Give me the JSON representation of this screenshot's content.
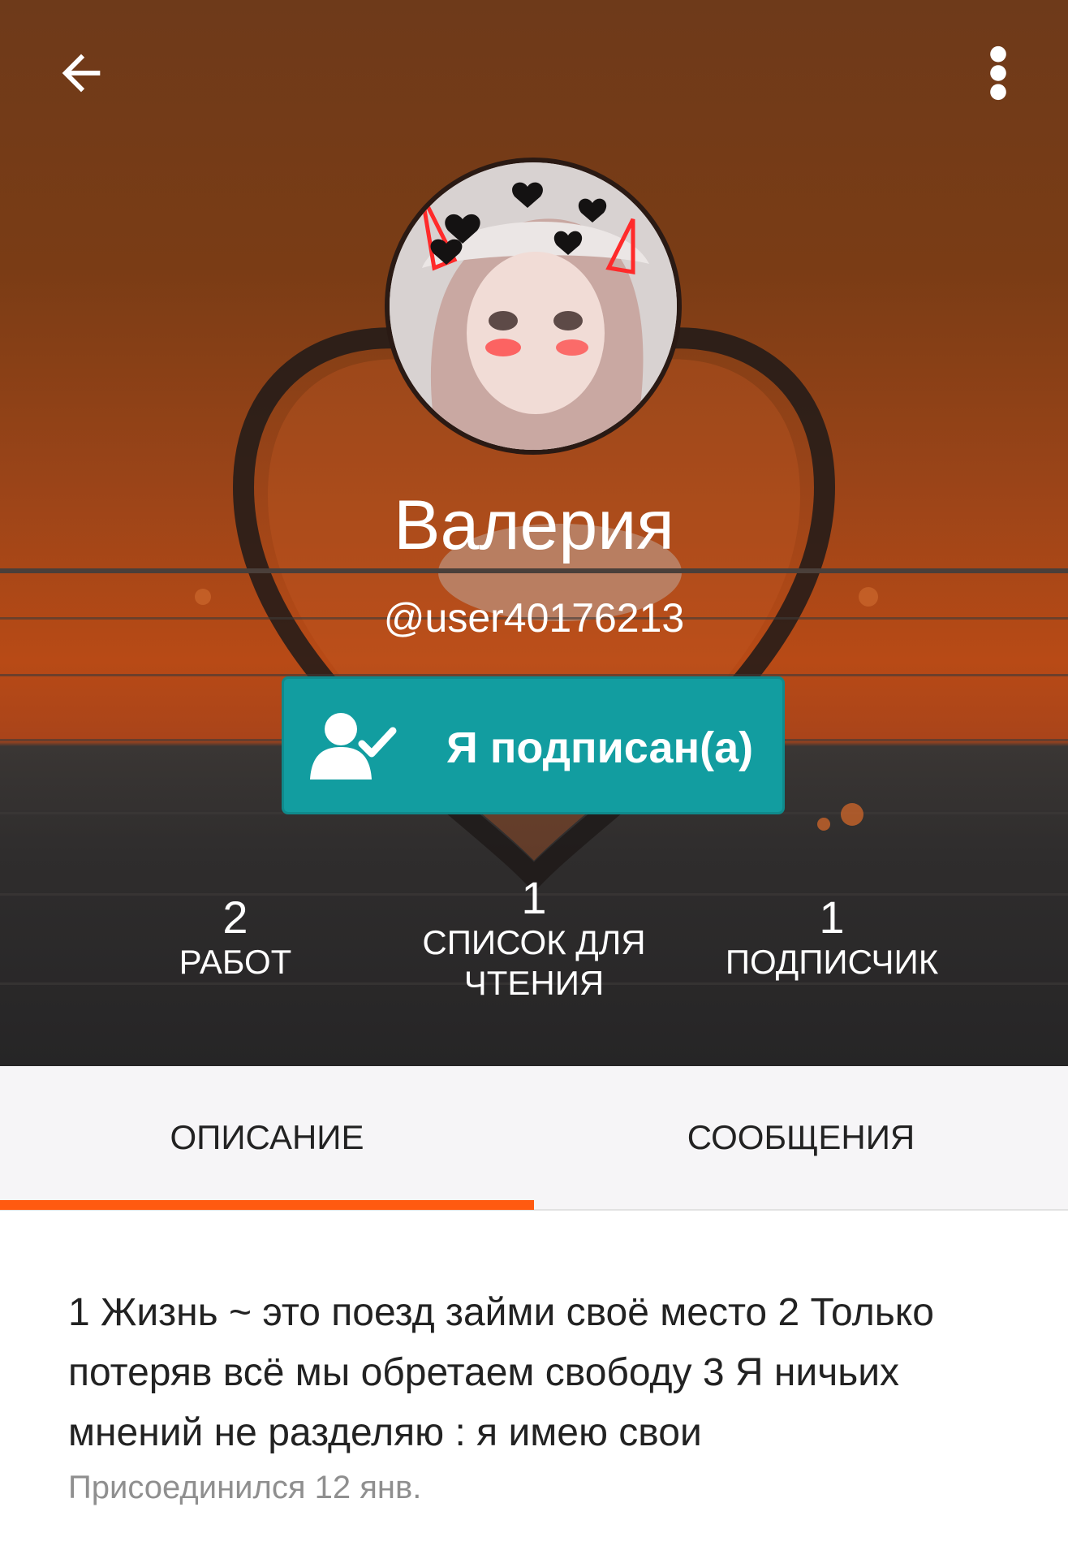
{
  "profile": {
    "name": "Валерия",
    "username": "@user40176213",
    "follow_button_label": "Я подписан(а)"
  },
  "stats": [
    {
      "value": "2",
      "label": "РАБОТ"
    },
    {
      "value": "1",
      "label": "СПИСОК ДЛЯ ЧТЕНИЯ"
    },
    {
      "value": "1",
      "label": "ПОДПИСЧИК"
    }
  ],
  "tabs": [
    {
      "label": "ОПИСАНИЕ",
      "active": true
    },
    {
      "label": "СООБЩЕНИЯ",
      "active": false
    }
  ],
  "about": {
    "bio": "1 Жизнь ~ это поезд займи своё место 2 Только потеряв всё мы обретаем свободу 3 Я ничьих мнений не разделяю : я имею свои",
    "joined": "Присоединился 12 янв."
  },
  "icons": {
    "back": "arrow-left-icon",
    "more": "more-vertical-icon",
    "follow": "user-check-icon"
  },
  "colors": {
    "follow_button": "#129da0",
    "tab_indicator": "#ff5a10"
  }
}
